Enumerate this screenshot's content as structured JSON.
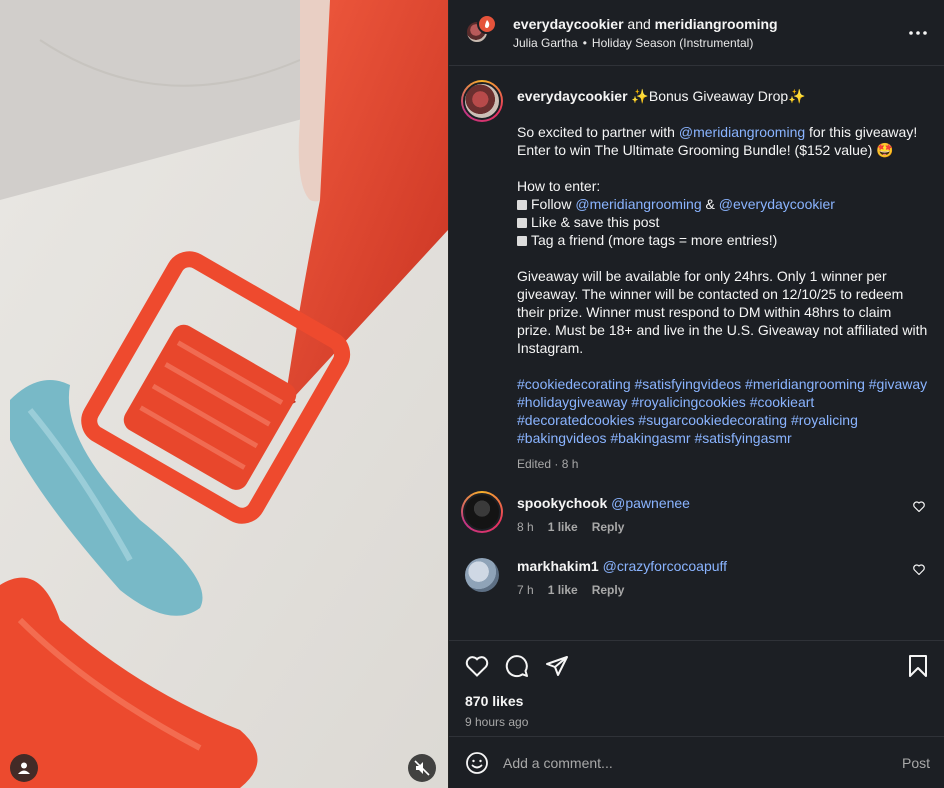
{
  "header": {
    "user1": "everydaycookier",
    "and_text": "and",
    "user2": "meridiangrooming",
    "audio_artist": "Julia Gartha",
    "audio_separator": "•",
    "audio_track": "Holiday Season (Instrumental)",
    "more_icon": "more-horizontal-icon"
  },
  "caption": {
    "username": "everydaycookier",
    "title_rest": " ✨Bonus Giveaway Drop✨",
    "intro_1": "So excited to partner with ",
    "intro_mention": "@meridiangrooming",
    "intro_2": " for this giveaway! Enter to win The Ultimate Grooming Bundle! ($152 value) 🤩",
    "how_to": "How to enter:",
    "step1_a": "Follow ",
    "step1_m1": "@meridiangrooming",
    "step1_and": " & ",
    "step1_m2": "@everydaycookier",
    "step2": "Like & save this post",
    "step3": "Tag a friend (more tags = more entries!)",
    "details": "Giveaway will be available for only 24hrs. Only 1 winner per giveaway. The winner will be contacted on 12/10/25 to redeem their prize. Winner must respond to DM within 48hrs to claim prize. Must be 18+ and live in the U.S. Giveaway not affiliated with Instagram.",
    "hashtags": "#cookiedecorating #satisfyingvideos #meridiangrooming #givaway #holidaygiveaway #royalicingcookies #cookieart #decoratedcookies #sugarcookiedecorating #royalicing #bakingvideos #bakingasmr #satisfyingasmr",
    "edited": "Edited · 8 h"
  },
  "comments": [
    {
      "username": "spookychook",
      "mention": "@pawnenee",
      "time": "8 h",
      "likes": "1 like",
      "reply": "Reply"
    },
    {
      "username": "markhakim1",
      "mention": "@crazyforcocoapuff",
      "time": "7 h",
      "likes": "1 like",
      "reply": "Reply"
    }
  ],
  "actions": {
    "likes": "870 likes",
    "time_ago": "9 hours ago",
    "icons": [
      "heart-icon",
      "comment-icon",
      "share-icon",
      "bookmark-icon"
    ]
  },
  "comment_box": {
    "placeholder": "Add a comment...",
    "post_label": "Post",
    "emoji_icon": "emoji-icon"
  },
  "colors": {
    "panel_bg": "#1c1f24",
    "link": "#8ab4ff",
    "icing_red": "#ee4a2e",
    "icing_blue": "#78b9c7"
  }
}
